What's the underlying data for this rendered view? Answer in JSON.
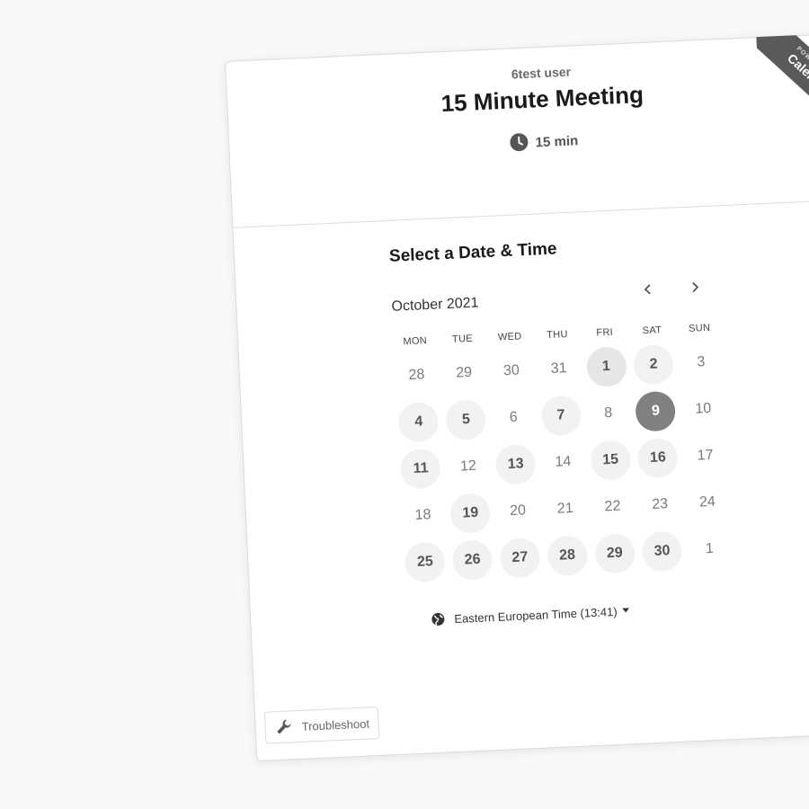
{
  "event": {
    "host_name": "6test user",
    "title": "15 Minute Meeting",
    "duration": "15 min",
    "duration_icon": "clock-icon"
  },
  "ribbon": {
    "line1": "POWERED BY",
    "line2": "Calendly"
  },
  "scheduler": {
    "section_title": "Select a Date & Time",
    "month_label": "October 2021",
    "prev_icon": "chevron-left-icon",
    "next_icon": "chevron-right-icon",
    "weekdays": [
      "MON",
      "TUE",
      "WED",
      "THU",
      "FRI",
      "SAT",
      "SUN"
    ],
    "days": [
      {
        "label": "28",
        "state": "other"
      },
      {
        "label": "29",
        "state": "other"
      },
      {
        "label": "30",
        "state": "other"
      },
      {
        "label": "31",
        "state": "other"
      },
      {
        "label": "1",
        "state": "available-focused"
      },
      {
        "label": "2",
        "state": "available"
      },
      {
        "label": "3",
        "state": "unavailable"
      },
      {
        "label": "4",
        "state": "available"
      },
      {
        "label": "5",
        "state": "available"
      },
      {
        "label": "6",
        "state": "unavailable"
      },
      {
        "label": "7",
        "state": "available"
      },
      {
        "label": "8",
        "state": "unavailable"
      },
      {
        "label": "9",
        "state": "selected"
      },
      {
        "label": "10",
        "state": "unavailable"
      },
      {
        "label": "11",
        "state": "available"
      },
      {
        "label": "12",
        "state": "unavailable"
      },
      {
        "label": "13",
        "state": "available"
      },
      {
        "label": "14",
        "state": "unavailable"
      },
      {
        "label": "15",
        "state": "available"
      },
      {
        "label": "16",
        "state": "available"
      },
      {
        "label": "17",
        "state": "unavailable"
      },
      {
        "label": "18",
        "state": "unavailable"
      },
      {
        "label": "19",
        "state": "available"
      },
      {
        "label": "20",
        "state": "unavailable"
      },
      {
        "label": "21",
        "state": "unavailable"
      },
      {
        "label": "22",
        "state": "unavailable"
      },
      {
        "label": "23",
        "state": "unavailable"
      },
      {
        "label": "24",
        "state": "unavailable"
      },
      {
        "label": "25",
        "state": "available"
      },
      {
        "label": "26",
        "state": "available"
      },
      {
        "label": "27",
        "state": "available"
      },
      {
        "label": "28",
        "state": "available"
      },
      {
        "label": "29",
        "state": "available"
      },
      {
        "label": "30",
        "state": "available"
      },
      {
        "label": "1",
        "state": "other"
      }
    ],
    "timezone": {
      "label": "Eastern European Time (13:41)",
      "icon": "globe-icon"
    }
  },
  "troubleshoot": {
    "label": "Troubleshoot",
    "icon": "wrench-icon"
  },
  "colors": {
    "selected_day": "#808080",
    "available_day": "#f2f2f2",
    "ribbon": "#5a5a5a"
  }
}
